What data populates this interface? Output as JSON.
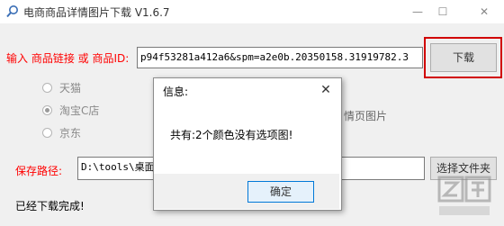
{
  "window": {
    "title": "电商商品详情图片下载 V1.6.7",
    "minimize": "—",
    "maximize": "☐",
    "close": "✕"
  },
  "product_input": {
    "label": "输入 商品链接 或 商品ID:",
    "value": "p94f53281a412a6&spm=a2e0b.20350158.31919782.3"
  },
  "download_button": {
    "label": "下载"
  },
  "radios": [
    {
      "label": "天猫",
      "checked": false
    },
    {
      "label": "淘宝C店",
      "checked": true
    },
    {
      "label": "京东",
      "checked": false
    }
  ],
  "partial_option_label": "情页图片",
  "save_path": {
    "label": "保存路径:",
    "value": "D:\\tools\\桌面"
  },
  "choose_folder_button": {
    "label": "选择文件夹"
  },
  "status": "已经下载完成!",
  "dialog": {
    "title": "信息:",
    "close": "✕",
    "message": "共有:2个颜色没有选项图!",
    "ok_label": "确定"
  },
  "colors": {
    "highlight": "#d10000",
    "label_red": "#ff0000",
    "ok_border": "#0078d7"
  },
  "icons": {
    "app": "search-icon",
    "watermark": "brand-watermark-icon"
  }
}
